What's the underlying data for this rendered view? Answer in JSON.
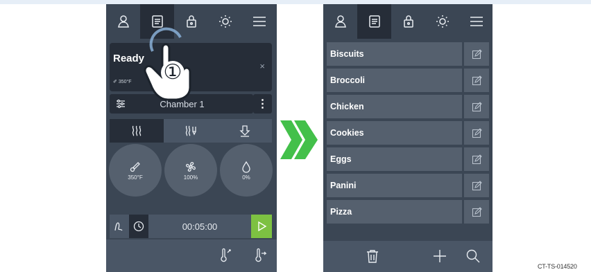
{
  "left_screen": {
    "nav": {
      "tabs": [
        {
          "icon": "user-icon",
          "active": false
        },
        {
          "icon": "recipe-book-icon",
          "active": true
        },
        {
          "icon": "lock-icon",
          "active": false
        },
        {
          "icon": "brightness-icon",
          "active": false
        },
        {
          "icon": "menu-icon",
          "active": false
        }
      ]
    },
    "status_card": {
      "title": "Ready",
      "temperature": "350°F",
      "close": "×"
    },
    "chamber": {
      "name": "Chamber 1",
      "menu": "⋮"
    },
    "modes": [
      {
        "icon": "heat-mode-icon",
        "active": true
      },
      {
        "icon": "heat-fan-mode-icon",
        "active": false
      },
      {
        "icon": "fan-down-mode-icon",
        "active": false
      }
    ],
    "dials": [
      {
        "icon": "temperature-probe-icon",
        "value": "350°F"
      },
      {
        "icon": "fan-icon",
        "value": "100%"
      },
      {
        "icon": "humidity-icon",
        "value": "0%"
      }
    ],
    "timer": {
      "time": "00:05:00"
    },
    "callout_number": "①"
  },
  "right_screen": {
    "recipes": [
      {
        "name": "Biscuits"
      },
      {
        "name": "Broccoli"
      },
      {
        "name": "Chicken"
      },
      {
        "name": "Cookies"
      },
      {
        "name": "Eggs"
      },
      {
        "name": "Panini"
      },
      {
        "name": "Pizza"
      }
    ]
  },
  "colors": {
    "panel": "#3b4654",
    "dark": "#262d38",
    "row": "#55606e",
    "accent_green": "#7dc142",
    "arrow_green": "#43c04a"
  },
  "figure_code": "CT-TS-014520"
}
